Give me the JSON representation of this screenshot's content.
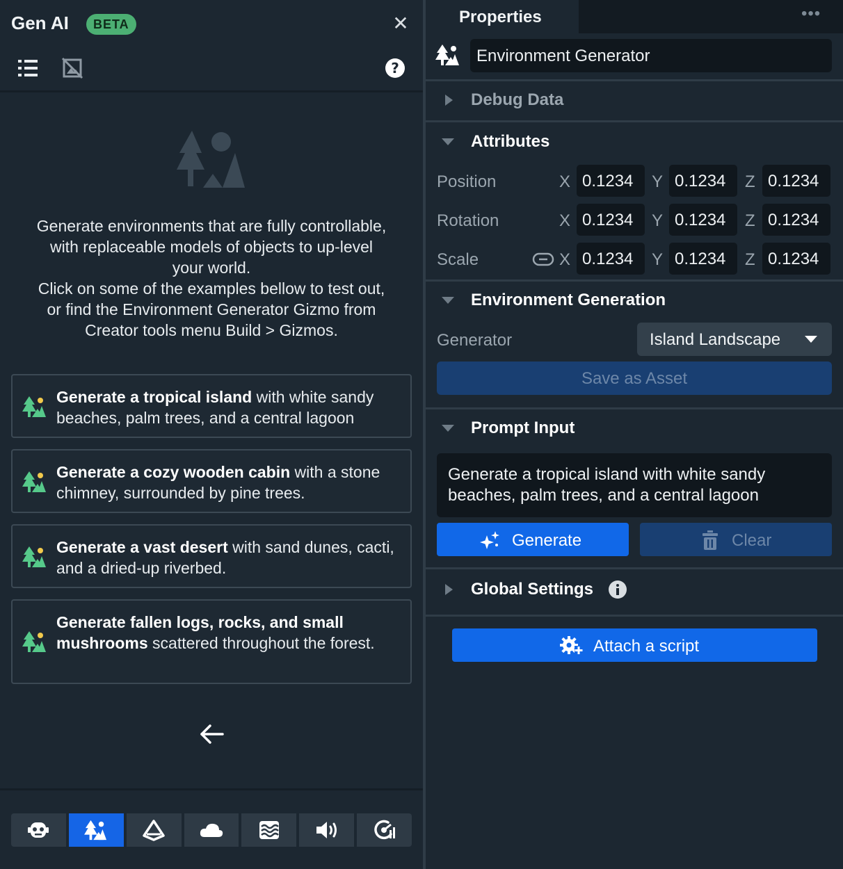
{
  "left_panel": {
    "title": "Gen AI",
    "badge": "BETA",
    "close_glyph": "✕",
    "description_lines": [
      "Generate environments that are fully controllable,",
      "with replaceable models of objects to up-level",
      "your world.",
      "Click on some of the examples bellow to test out,",
      "or find the Environment Generator Gizmo from",
      "Creator tools menu Build > Gizmos."
    ],
    "examples": [
      {
        "bold": "Generate a tropical island",
        "rest": " with white sandy beaches, palm trees, and a central lagoon"
      },
      {
        "bold": "Generate a cozy wooden cabin",
        "rest": " with a stone chimney, surrounded by pine trees."
      },
      {
        "bold": "Generate a vast desert",
        "rest": " with sand dunes, cacti, and a dried-up riverbed."
      },
      {
        "bold": "Generate fallen logs, rocks, and small mushrooms",
        "rest": " scattered throughout the forest."
      }
    ],
    "bottom_tabs": [
      "robot-icon",
      "environment-icon",
      "prism-icon",
      "cloud-icon",
      "water-icon",
      "audio-icon",
      "analytics-icon"
    ],
    "active_tab_index": 1
  },
  "right_panel": {
    "tab_title": "Properties",
    "more_glyph": "•••",
    "object_name": "Environment Generator",
    "sections": {
      "debug": "Debug Data",
      "attributes": "Attributes",
      "env_gen": "Environment Generation",
      "prompt": "Prompt Input",
      "global": "Global Settings"
    },
    "attributes": {
      "position": {
        "label": "Position",
        "x": "0.1234",
        "y": "0.1234",
        "z": "0.1234"
      },
      "rotation": {
        "label": "Rotation",
        "x": "0.1234",
        "y": "0.1234",
        "z": "0.1234"
      },
      "scale": {
        "label": "Scale",
        "x": "0.1234",
        "y": "0.1234",
        "z": "0.1234"
      },
      "axes": {
        "x": "X",
        "y": "Y",
        "z": "Z"
      }
    },
    "generator": {
      "label": "Generator",
      "selected": "Island Landscape",
      "save_label": "Save as Asset"
    },
    "prompt": {
      "line1": "Generate a tropical island with white sandy",
      "line2": "beaches, palm trees, and a central lagoon"
    },
    "buttons": {
      "generate": "Generate",
      "clear": "Clear",
      "attach": "Attach a script"
    }
  },
  "colors": {
    "background": "#1c2731",
    "accent_blue": "#1168e8",
    "disabled_blue": "#193f72",
    "beta_green": "#4caf73",
    "env_icon_green": "#56c98a",
    "env_icon_yellow": "#f2c94c"
  }
}
